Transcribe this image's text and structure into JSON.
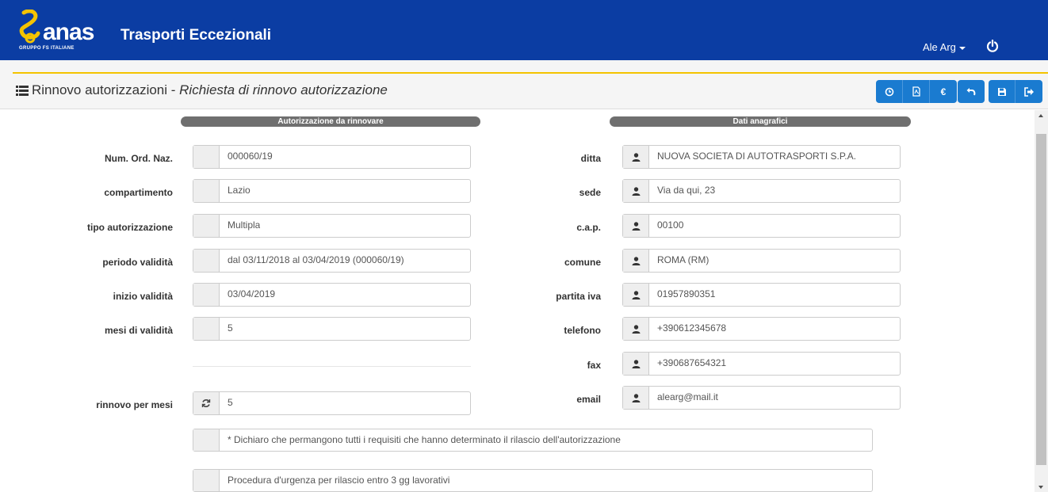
{
  "header": {
    "logo_text": "anas",
    "logo_subtext": "GRUPPO FS ITALIANE",
    "app_title": "Trasporti Eccezionali",
    "user_name": "Ale Arg",
    "colors": {
      "navbar": "#0b3da3",
      "accent": "#f4c300",
      "button": "#1a7bd0"
    }
  },
  "page": {
    "title": "Rinnovo autorizzazioni",
    "separator": " - ",
    "subtitle": "Richiesta di rinnovo autorizzazione"
  },
  "toolbar": {
    "buttons": [
      {
        "icon": "history-icon"
      },
      {
        "icon": "pdf-icon"
      },
      {
        "icon": "euro-icon",
        "label": "€"
      },
      {
        "icon": "undo-icon"
      },
      {
        "icon": "save-icon"
      },
      {
        "icon": "exit-icon"
      }
    ]
  },
  "left_section": {
    "header": "Autorizzazione da rinnovare",
    "fields": [
      {
        "label": "Num. Ord. Naz.",
        "value": "000060/19"
      },
      {
        "label": "compartimento",
        "value": "Lazio"
      },
      {
        "label": "tipo autorizzazione",
        "value": "Multipla"
      },
      {
        "label": "periodo validità",
        "value": "dal 03/11/2018 al 03/04/2019 (000060/19)"
      },
      {
        "label": "inizio validità",
        "value": "03/04/2019"
      },
      {
        "label": "mesi di validità",
        "value": "5"
      }
    ],
    "renewal": {
      "label": "rinnovo per mesi",
      "value": "5",
      "icon": "refresh-icon"
    }
  },
  "right_section": {
    "header": "Dati anagrafici",
    "fields": [
      {
        "label": "ditta",
        "value": "NUOVA SOCIETA DI AUTOTRASPORTI S.P.A."
      },
      {
        "label": "sede",
        "value": "Via da qui, 23"
      },
      {
        "label": "c.a.p.",
        "value": "00100"
      },
      {
        "label": "comune",
        "value": "ROMA (RM)"
      },
      {
        "label": "partita iva",
        "value": "01957890351"
      },
      {
        "label": "telefono",
        "value": "+390612345678"
      },
      {
        "label": "fax",
        "value": "+390687654321"
      },
      {
        "label": "email",
        "value": "alearg@mail.it"
      }
    ]
  },
  "checkboxes": [
    {
      "label": "* Dichiaro che permangono tutti i requisiti che hanno determinato il rilascio dell'autorizzazione"
    },
    {
      "label": "Procedura d'urgenza per rilascio entro 3 gg lavorativi"
    }
  ]
}
